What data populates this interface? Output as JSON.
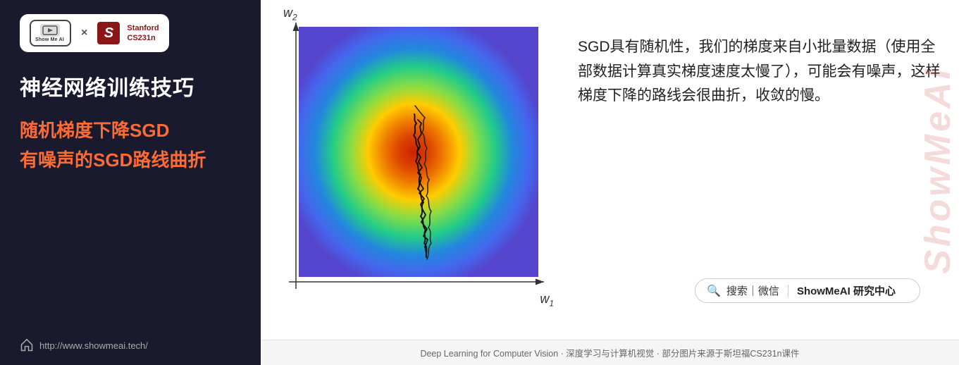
{
  "left": {
    "main_title": "神经网络训练技巧",
    "subtitle1": "随机梯度下降SGD",
    "subtitle2": "有噪声的SGD路线曲折",
    "footer_url": "http://www.showmeai.tech/",
    "logo_x": "×",
    "stanford_label1": "Stanford",
    "stanford_label2": "CS231n",
    "showmeai_label": "Show Me AI"
  },
  "right": {
    "axis_w2": "w₂",
    "axis_w1": "w₁",
    "description": "SGD具有随机性，我们的梯度来自小批量数据（使用全部数据计算真实梯度速度太慢了），可能会有噪声，这样梯度下降的路线会很曲折，收敛的慢。",
    "search_text": "搜索｜微信",
    "search_brand": "ShowMeAI 研究中心",
    "footer_text": "Deep Learning for Computer Vision · 深度学习与计算机视觉 · 部分图片来源于斯坦福CS231n课件",
    "watermark": "ShowMeAI"
  }
}
